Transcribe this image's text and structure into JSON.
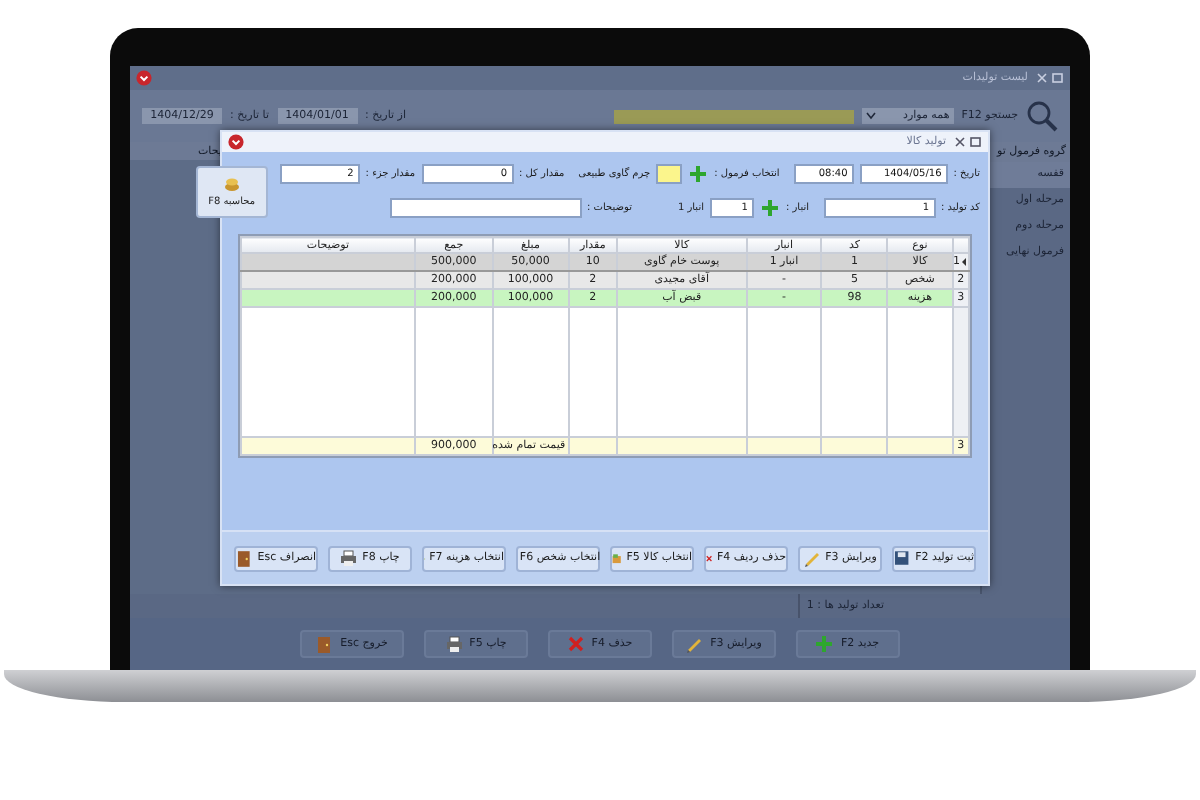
{
  "window": {
    "title": "لیست تولیدات"
  },
  "toolbar": {
    "search_label": "جستجو F12",
    "filter": {
      "value": "همه موارد"
    },
    "from_label": "از تاریخ :",
    "from_date": "1404/01/01",
    "to_label": "تا تاریخ :",
    "to_date": "1404/12/29"
  },
  "sidebar": {
    "title": "گروه فرمول تو",
    "items": [
      {
        "label": "قفسه",
        "selected": true
      },
      {
        "label": "مرحله اول",
        "selected": false
      },
      {
        "label": "مرحله دوم",
        "selected": false
      },
      {
        "label": "فرمول نهایی",
        "selected": false
      }
    ]
  },
  "list": {
    "column_1": "یحات"
  },
  "status": "تعداد تولید ها : 1",
  "buttons": [
    {
      "label": "جدید F2"
    },
    {
      "label": "ویرایش F3"
    },
    {
      "label": "حذف F4"
    },
    {
      "label": "چاپ F5"
    },
    {
      "label": "خروج Esc"
    }
  ],
  "dialog": {
    "title": "تولید کالا",
    "date_label": "تاریخ :",
    "date": "1404/05/16",
    "time": "08:40",
    "formula_label": "انتخاب فرمول :",
    "formula_name": "چرم گاوی طبیعی",
    "total_label": "مقدار کل :",
    "total": "0",
    "part_label": "مقدار جزء :",
    "part": "2",
    "calc_button": "محاسبه F8",
    "code_label": "کد تولید :",
    "code": "1",
    "store_label": "انبار :",
    "store_code": "1",
    "store_name": "انبار 1",
    "notes_label": "توضیحات :",
    "table": {
      "columns": [
        "نوع",
        "کد",
        "انبار",
        "کالا",
        "مقدار",
        "مبلغ",
        "جمع",
        "توضیحات"
      ],
      "rows": [
        {
          "index": "1",
          "selected": true,
          "color": "#d4d4d4",
          "cells": [
            "کالا",
            "1",
            "انبار 1",
            "پوست خام گاوی",
            "10",
            "50,000",
            "500,000",
            ""
          ]
        },
        {
          "index": "2",
          "selected": false,
          "color": "#e8e8e8",
          "cells": [
            "شخص",
            "5",
            "-",
            "آقای مجیدی",
            "2",
            "100,000",
            "200,000",
            ""
          ]
        },
        {
          "index": "3",
          "selected": false,
          "color": "#c8f5c0",
          "cells": [
            "هزینه",
            "98",
            "-",
            "قبض آب",
            "2",
            "100,000",
            "200,000",
            ""
          ]
        }
      ],
      "footer": {
        "index": "3",
        "label": "قیمت تمام شده",
        "total": "900,000"
      }
    },
    "buttons": [
      {
        "label": "ثبت تولید F2"
      },
      {
        "label": "ویرایش F3"
      },
      {
        "label": "حذف ردیف F4"
      },
      {
        "label": "انتخاب کالا F5"
      },
      {
        "label": "انتخاب شخص F6"
      },
      {
        "label": "انتخاب هزینه F7"
      },
      {
        "label": "چاپ F8"
      },
      {
        "label": "انصراف Esc"
      }
    ]
  }
}
